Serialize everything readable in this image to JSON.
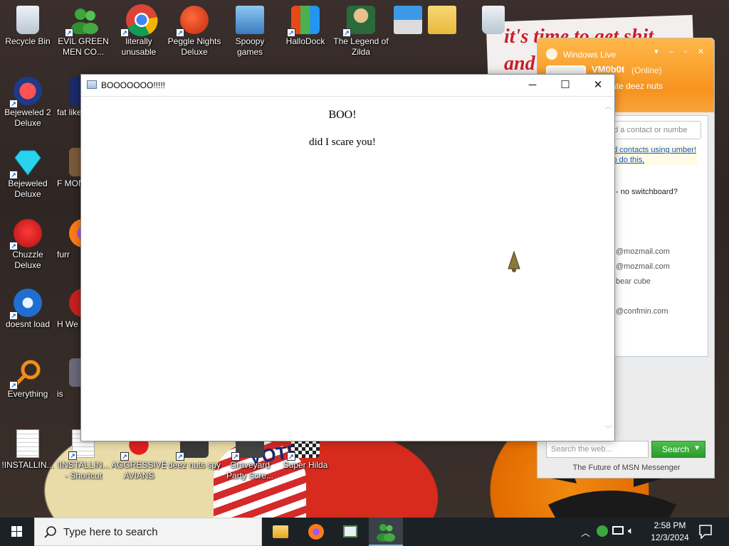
{
  "desktop": {
    "wallpaper_text": [
      "it's time to get shit",
      "and"
    ],
    "vote_text": "VOTE",
    "icons": [
      {
        "label": "Recycle Bin",
        "icon": "recycle-bin-icon"
      },
      {
        "label": "EVIL GREEN MEN CO...",
        "icon": "msn-buddies-icon"
      },
      {
        "label": "literally unusable",
        "icon": "chrome-icon"
      },
      {
        "label": "Peggle Nights Deluxe",
        "icon": "peggle-icon"
      },
      {
        "label": "Spoopy games",
        "icon": "network-computers-icon"
      },
      {
        "label": "HalloDock",
        "icon": "dock-icon"
      },
      {
        "label": "The Legend of Zilda",
        "icon": "game-character-icon"
      },
      {
        "label": "Bejeweled 2 Deluxe",
        "icon": "bejeweled2-icon"
      },
      {
        "label": "fat like",
        "icon": "app-icon"
      },
      {
        "label": "Bejeweled Deluxe",
        "icon": "diamond-icon"
      },
      {
        "label": "F MON",
        "icon": "app-icon"
      },
      {
        "label": "Chuzzle Deluxe",
        "icon": "chuzzle-icon"
      },
      {
        "label": "furr",
        "icon": "firefox-icon"
      },
      {
        "label": "doesnt load",
        "icon": "thunderbird-icon"
      },
      {
        "label": "H We",
        "icon": "app-icon"
      },
      {
        "label": "Everything",
        "icon": "search-magnifier-icon"
      },
      {
        "label": "is",
        "icon": "app-icon"
      },
      {
        "label": "!INSTALLIN...",
        "icon": "document-icon"
      },
      {
        "label": "!INSTALLIN... - Shortcut",
        "icon": "document-icon"
      },
      {
        "label": "AGGRESSIVE AVIANS",
        "icon": "angry-bird-icon"
      },
      {
        "label": "deez nuts spy",
        "icon": "spy-icon"
      },
      {
        "label": "Graveyard Party Scre...",
        "icon": "graveyard-icon"
      },
      {
        "label": "Super Hilda",
        "icon": "pixel-game-icon"
      }
    ]
  },
  "msn": {
    "title": "Windows Live",
    "user": "VM0b0t",
    "status": "(Online)",
    "personal_message": "rate deez nuts",
    "find_placeholder": "nd a contact or numbe",
    "info_text": "dd contacts using umber! To do this,",
    "contacts": [
      "- no switchboard?",
      "@mozmail.com",
      "@mozmail.com",
      "bear cube",
      "@confmin.com"
    ],
    "web_search_placeholder": "Search the web...",
    "search_button": "Search",
    "footer": "The Future of MSN Messenger"
  },
  "dialog": {
    "title": "BOOOOOOO!!!!!",
    "heading": "BOO!",
    "message": "did I scare you!"
  },
  "taskbar": {
    "search_placeholder": "Type here to search",
    "time": "2:58 PM",
    "date": "12/3/2024",
    "pinned": [
      "file-explorer-icon",
      "firefox-icon",
      "app-window-icon",
      "msn-buddies-icon"
    ],
    "active_index": 3
  },
  "colors": {
    "msn_orange": "#f7931e",
    "taskbar": "#1c2125",
    "accent_blue": "#76b9ed",
    "search_green": "#2a9a2a"
  }
}
